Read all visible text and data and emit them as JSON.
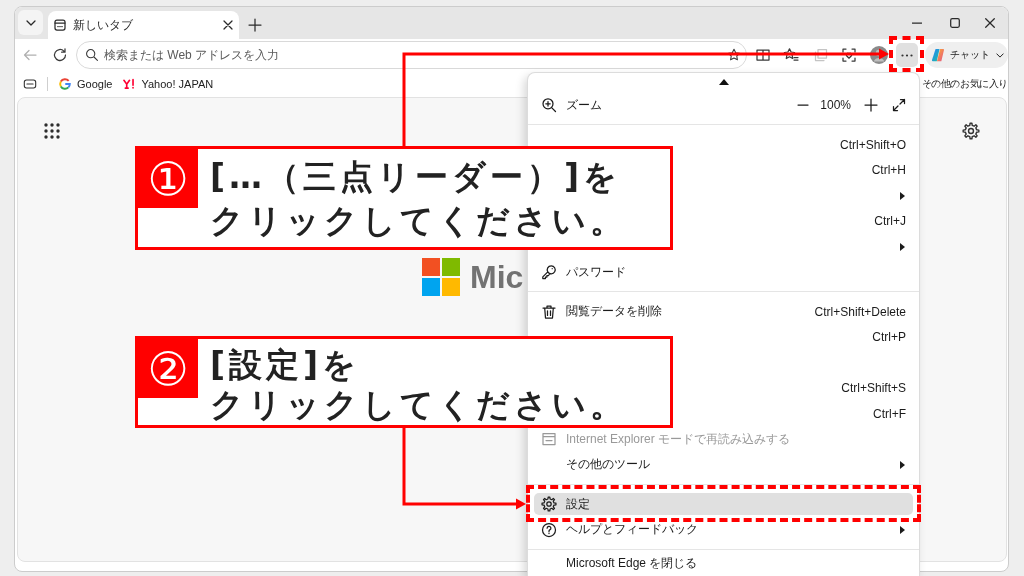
{
  "tab_strip": {
    "tabs": [
      {
        "title": "新しいタブ",
        "selected": true
      }
    ]
  },
  "toolbar": {
    "back_button": {
      "disabled": true
    },
    "address_bar": {
      "placeholder": "検索または Web アドレスを入力"
    },
    "buttons": [
      {
        "disabled": false
      },
      {
        "disabled": false
      },
      {
        "disabled": true
      },
      {
        "disabled": false
      }
    ],
    "more_button": {
      "active": true
    },
    "chat_button": {
      "label": "チャット"
    }
  },
  "favorites_bar": {
    "items": [
      {
        "label": "Google"
      },
      {
        "label": "Yahoo! JAPAN"
      }
    ],
    "other_favorites": "その他のお気に入り"
  },
  "new_tab_page": {
    "logo_text": "Mic"
  },
  "menu": {
    "sections": [
      {
        "items": [
          {
            "kind": "zoom",
            "label": "ズーム",
            "value": "100%"
          }
        ]
      },
      {
        "items": [
          {
            "kind": "covered",
            "shortcut": "Ctrl+Shift+O",
            "submenu": false,
            "selected": false
          },
          {
            "kind": "covered",
            "shortcut": "Ctrl+H",
            "submenu": false,
            "selected": false
          },
          {
            "kind": "covered",
            "submenu": true,
            "selected": false
          },
          {
            "kind": "covered",
            "shortcut": "Ctrl+J",
            "submenu": false,
            "selected": false
          },
          {
            "kind": "covered",
            "submenu": true,
            "selected": false
          },
          {
            "kind": "command",
            "label": "パスワード",
            "submenu": false,
            "disabled": false,
            "selected": false
          }
        ]
      },
      {
        "items": [
          {
            "kind": "command",
            "label": "閲覧データを削除",
            "shortcut": "Ctrl+Shift+Delete",
            "submenu": false,
            "disabled": false,
            "selected": false
          },
          {
            "kind": "covered",
            "shortcut": "Ctrl+P",
            "submenu": false,
            "selected": false
          },
          {
            "kind": "covered",
            "submenu": false,
            "selected": false
          },
          {
            "kind": "covered",
            "shortcut": "Ctrl+Shift+S",
            "submenu": false,
            "selected": false
          },
          {
            "kind": "covered",
            "shortcut": "Ctrl+F",
            "submenu": false,
            "selected": false
          },
          {
            "kind": "command",
            "label": "Internet Explorer モードで再読み込みする",
            "submenu": false,
            "disabled": true,
            "selected": false
          },
          {
            "kind": "command",
            "label": "その他のツール",
            "submenu": true,
            "disabled": false,
            "selected": false
          }
        ]
      },
      {
        "items": [
          {
            "kind": "command",
            "label": "設定",
            "submenu": false,
            "disabled": false,
            "selected": true
          },
          {
            "kind": "command",
            "label": "ヘルプとフィードバック",
            "submenu": true,
            "disabled": false,
            "selected": false
          }
        ]
      },
      {
        "items": [
          {
            "kind": "command",
            "label": "Microsoft Edge を閉じる",
            "submenu": false,
            "disabled": false,
            "selected": false
          }
        ]
      }
    ]
  },
  "callouts": [
    {
      "number": "①",
      "lines": [
        "[…（三点リーダー）]を",
        "クリックしてください。"
      ]
    },
    {
      "number": "②",
      "lines": [
        "[設定]を",
        "クリックしてください。"
      ]
    }
  ]
}
